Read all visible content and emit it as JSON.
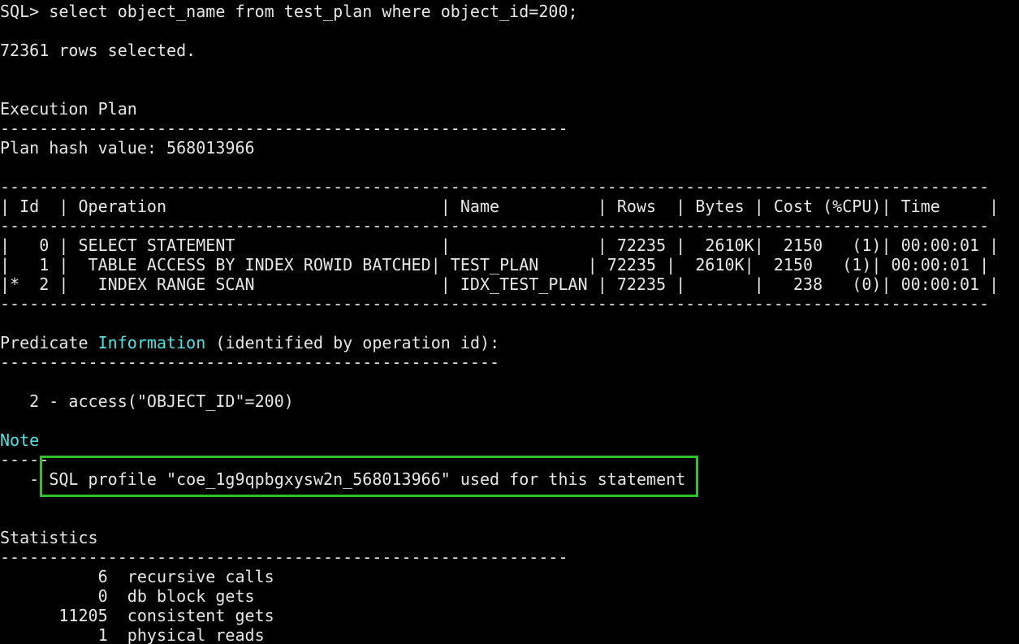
{
  "terminal": {
    "command": "SQL> select object_name from test_plan where object_id=200;",
    "rows_selected": "72361 rows selected.",
    "exec_plan": {
      "title": "Execution Plan",
      "separator": "----------------------------------------------------------",
      "hash_line": "Plan hash value: 568013966"
    },
    "plan_table": {
      "border": "-----------------------------------------------------------------------------------------------------",
      "header": "| Id  | Operation                            | Name          | Rows  | Bytes | Cost (%CPU)| Time     |",
      "rows": [
        "|   0 | SELECT STATEMENT                     |               | 72235 |  2610K|  2150   (1)| 00:00:01 |",
        "|   1 |  TABLE ACCESS BY INDEX ROWID BATCHED| TEST_PLAN     | 72235 |  2610K|  2150   (1)| 00:00:01 |",
        "|*  2 |   INDEX RANGE SCAN                   | IDX_TEST_PLAN | 72235 |       |   238   (0)| 00:00:01 |"
      ]
    },
    "predicate": {
      "prefix": "Predicate ",
      "highlight": "Information",
      "suffix": " (identified by operation id):",
      "separator": "---------------------------------------------------",
      "access_line": "   2 - access(\"OBJECT_ID\"=200)"
    },
    "note": {
      "title": "Note",
      "separator": "-----",
      "dash": "   - ",
      "profile_text": "SQL profile \"coe_1g9qpbgxysw2n_568013966\" used for this statement"
    },
    "statistics": {
      "title": "Statistics",
      "separator": "----------------------------------------------------------",
      "rows": [
        "          6  recursive calls",
        "          0  db block gets",
        "      11205  consistent gets",
        "          1  physical reads"
      ]
    }
  },
  "colors": {
    "background": "#000000",
    "text": "#e6e6e6",
    "cyan_highlight": "#4fe3e3",
    "box_border": "#2dc12d"
  }
}
